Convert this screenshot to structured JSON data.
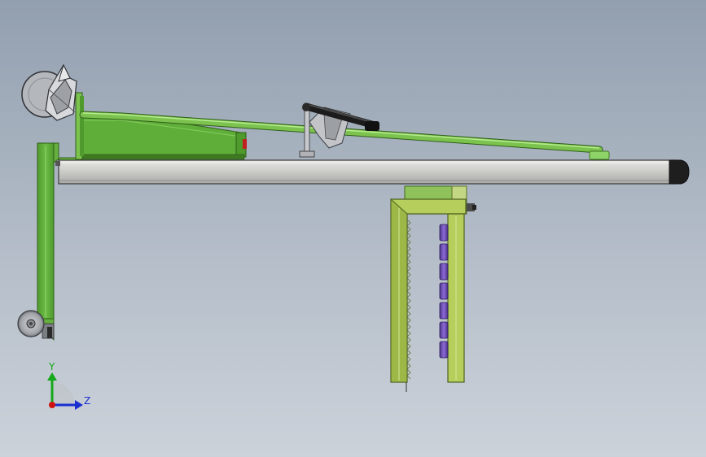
{
  "view": {
    "background_top": "#929faf",
    "background_bottom": "#ccd2da"
  },
  "colors": {
    "frame_green": "#66b040",
    "frame_green_dark": "#3f7a22",
    "stand_olive": "#b6cf5c",
    "stand_olive_dark": "#5c7228",
    "rail_grey": "#cfd0cc",
    "rail_grey_dark": "#4a4a4a",
    "roller_purple": "#7a56c4",
    "handle_black": "#222222",
    "wheel_grey": "#b2b4b8",
    "axis_x": "#d01010",
    "axis_y": "#14a81a",
    "axis_z": "#1a2fd0"
  },
  "triad": {
    "y_label": "Y",
    "z_label": "Z"
  }
}
